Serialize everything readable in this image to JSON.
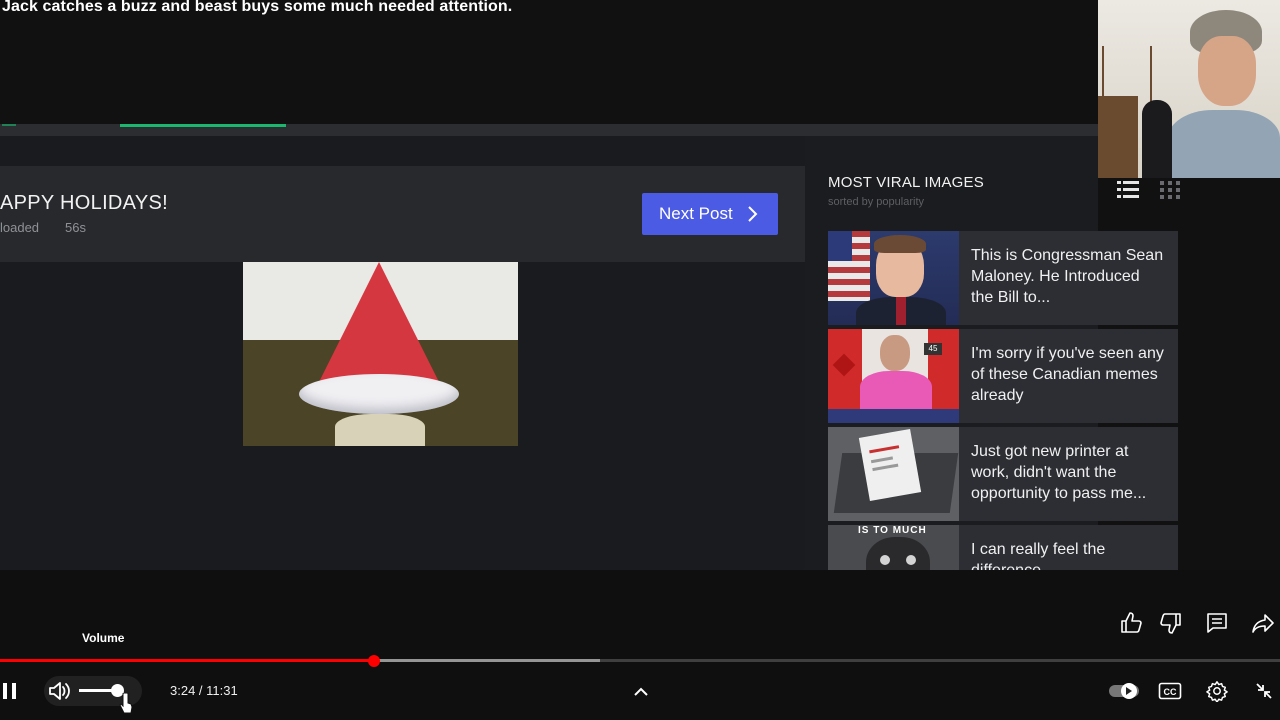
{
  "video": {
    "title": "Jack catches a buzz and beast buys some much needed attention."
  },
  "site": {
    "post": {
      "title": "APPY HOLIDAYS!",
      "meta_uploaded": "loaded",
      "meta_age": "56s",
      "next_post_label": "Next Post"
    },
    "sidebar": {
      "heading": "MOST VIRAL IMAGES",
      "subheading": "sorted by popularity",
      "items": [
        {
          "text": "This is Congressman Sean Maloney. He Introduced the Bill to..."
        },
        {
          "text": "I'm sorry if you've seen any of these Canadian memes already",
          "badge": "45"
        },
        {
          "text": "Just got new printer at work, didn't want the opportunity to pass me..."
        },
        {
          "text": "I can really feel the difference",
          "caption": "IS TO MUCH"
        }
      ]
    }
  },
  "player": {
    "tooltip": "Volume",
    "time": "3:24 / 11:31",
    "progress_played_fraction": 0.2919,
    "progress_buffered_fraction": 0.4688,
    "volume_fraction": 0.95,
    "colors": {
      "played": "#ff0000",
      "accent_button": "#4c5be3",
      "accent_green": "#1bb76e"
    }
  },
  "icons": {
    "pause": "pause-icon",
    "volume": "volume-icon",
    "chevron_up": "chevron-up-icon",
    "autoplay": "autoplay-toggle-icon",
    "cc": "closed-captions-icon",
    "settings": "gear-icon",
    "exit_fullscreen": "exit-fullscreen-icon",
    "like": "thumbs-up-icon",
    "dislike": "thumbs-down-icon",
    "comment": "comment-icon",
    "share": "share-icon"
  }
}
